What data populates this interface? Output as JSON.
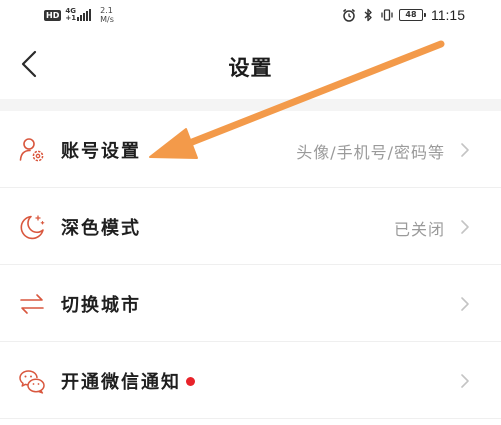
{
  "status_bar": {
    "hd": "HD",
    "network_top": "4G",
    "network_bottom": "+1",
    "speed_value": "2.1",
    "speed_unit": "M/s",
    "battery": "48",
    "time": "11:15",
    "icons": [
      "alarm-icon",
      "bluetooth-icon",
      "vibrate-icon",
      "battery-icon"
    ]
  },
  "nav": {
    "back_icon": "chevron-left-icon",
    "title": "设置"
  },
  "settings": [
    {
      "name": "account",
      "icon": "user-gear-icon",
      "label": "账号设置",
      "value": "头像/手机号/密码等",
      "has_dot": false
    },
    {
      "name": "dark-mode",
      "icon": "moon-stars-icon",
      "label": "深色模式",
      "value": "已关闭",
      "has_dot": false
    },
    {
      "name": "switch-city",
      "icon": "swap-arrows-icon",
      "label": "切换城市",
      "value": "",
      "has_dot": false
    },
    {
      "name": "wechat-notify",
      "icon": "wechat-icon",
      "label": "开通微信通知",
      "value": "",
      "has_dot": true
    }
  ],
  "colors": {
    "accent_icon": "#d9573e",
    "annotation_arrow": "#f39a4a",
    "red_dot": "#e8232a",
    "secondary_text": "#9a9a9a",
    "divider_band": "#f4f4f4"
  }
}
